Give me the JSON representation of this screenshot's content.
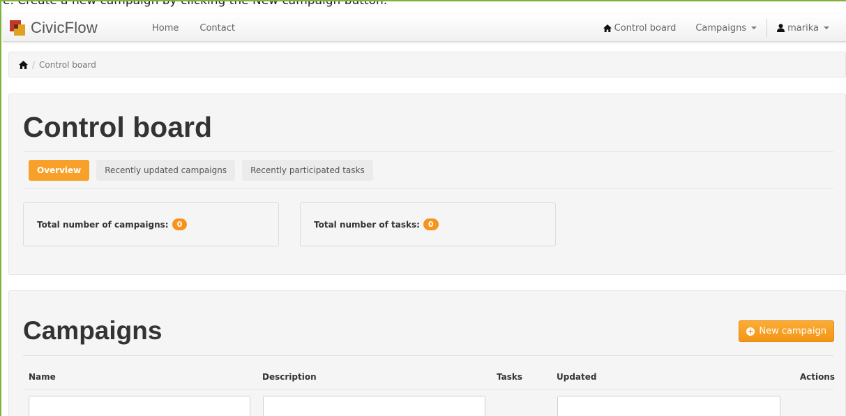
{
  "top_strip": {
    "text": "e. Create a new campaign by clicking the New campaign button."
  },
  "navbar": {
    "brand": "CivicFlow",
    "links": [
      "Home",
      "Contact"
    ],
    "control_board": "Control board",
    "campaigns": "Campaigns",
    "user": "marika"
  },
  "breadcrumb": {
    "current": "Control board",
    "separator": "/"
  },
  "control_board": {
    "title": "Control board",
    "tabs": [
      "Overview",
      "Recently updated campaigns",
      "Recently participated tasks"
    ],
    "active_tab": "Overview",
    "stats": [
      {
        "label": "Total number of campaigns:",
        "value": "0"
      },
      {
        "label": "Total number of tasks:",
        "value": "0"
      }
    ]
  },
  "campaigns": {
    "title": "Campaigns",
    "new_button": "New campaign",
    "columns": [
      "Name",
      "Description",
      "Tasks",
      "Updated",
      "Actions"
    ],
    "filters": {
      "name": "",
      "description": "",
      "updated": ""
    }
  },
  "colors": {
    "accent": "#f7a12b",
    "frame": "#7fb13c"
  }
}
